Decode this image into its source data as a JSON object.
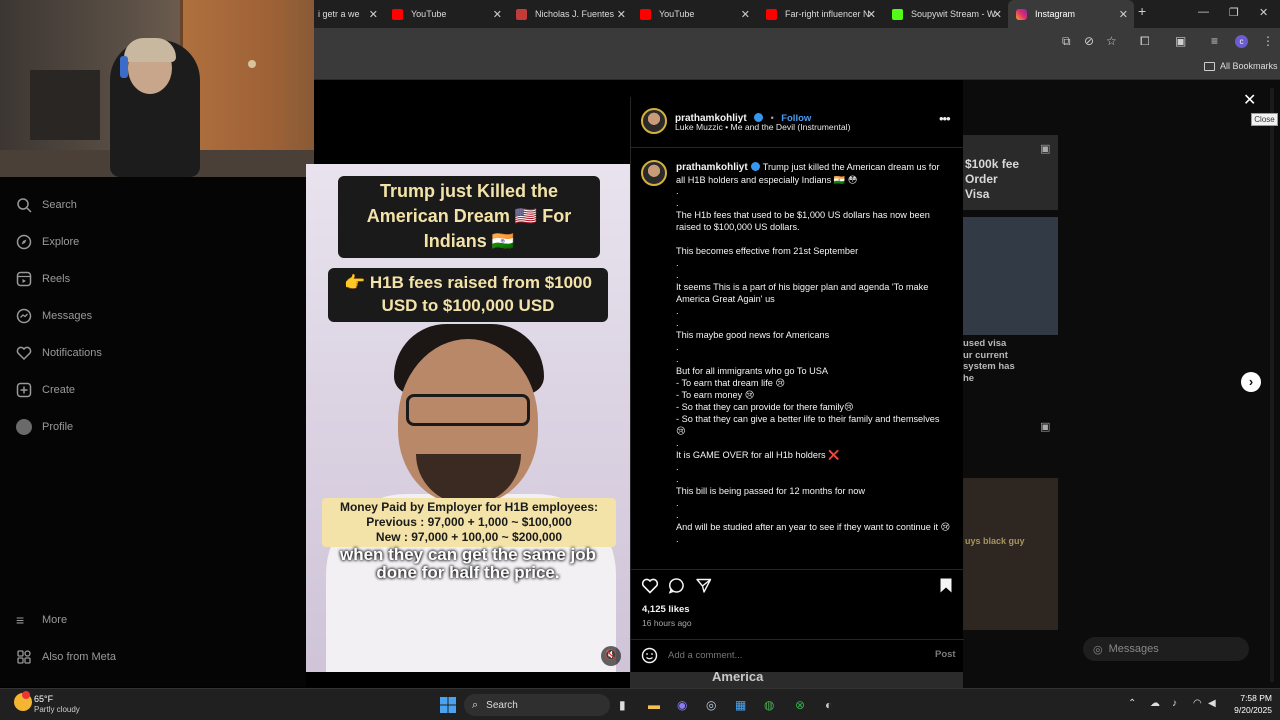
{
  "browser": {
    "tabs": [
      {
        "title": "i getr a we",
        "favicon_color": "#888888",
        "active": false
      },
      {
        "title": "YouTube",
        "favicon_color": "#ff0000",
        "active": false
      },
      {
        "title": "Nicholas J. Fuentes",
        "favicon_color": "#c23b3b",
        "active": false
      },
      {
        "title": "YouTube",
        "favicon_color": "#ff0000",
        "active": false
      },
      {
        "title": "Far-right influencer N",
        "favicon_color": "#ff0000",
        "active": false
      },
      {
        "title": "Soupywit Stream - W",
        "favicon_color": "#53fc18",
        "active": false
      },
      {
        "title": "Instagram",
        "favicon_color": "#e1306c",
        "active": true
      }
    ],
    "bookmarks_label": "All Bookmarks"
  },
  "sidebar": {
    "items": [
      {
        "label": "Search",
        "icon": "search-icon"
      },
      {
        "label": "Explore",
        "icon": "compass-icon"
      },
      {
        "label": "Reels",
        "icon": "reels-icon"
      },
      {
        "label": "Messages",
        "icon": "messenger-icon"
      },
      {
        "label": "Notifications",
        "icon": "heart-icon"
      },
      {
        "label": "Create",
        "icon": "plus-square-icon"
      },
      {
        "label": "Profile",
        "icon": "avatar-icon"
      }
    ],
    "more_label": "More",
    "meta_label": "Also from Meta"
  },
  "reel": {
    "headline": "Trump just Killed the American Dream 🇺🇸 For Indians 🇮🇳",
    "subheadline": "👉 H1B fees raised from $1000 USD to $100,000 USD",
    "overlay_lines": [
      "Money Paid by Employer for H1B employees:",
      "Previous : 97,000 + 1,000 ~ $100,000",
      "New : 97,000 + 100,00 ~ $200,000"
    ],
    "caption": "when they can get the same job done for half the price."
  },
  "post": {
    "username": "prathamkohliyt",
    "follow_label": "Follow",
    "audio": "Luke Muzzic • Me and the Devil (Instrumental)",
    "caption_lead": "Trump just killed the American dream us for all H1B holders and especially Indians 🇮🇳 😳",
    "caption_body": ".\n.\nThe H1b fees that used to be $1,000 US dollars has now been raised to $100,000 US dollars.\n\nThis becomes effective from 21st September\n.\n.\nIt seems This is a part of his bigger plan and agenda 'To make America Great Again' us\n.\n.\nThis maybe good news for Americans\n.\n.\nBut for all immigrants who go To USA\n- To earn that dream life 😢\n- To earn money 😢\n- So that they can provide for there family😢\n- So that they can give a better life to their family and themselves 😢\n.\nIt is GAME OVER for all H1b holders ❌\n.\n.\nThis bill is being passed for 12 months for now\n.\n.\nAnd will be studied after an year to see if they want to continue it 😢\n.",
    "likes": "4,125 likes",
    "time": "16 hours ago",
    "comment_placeholder": "Add a comment...",
    "post_label": "Post"
  },
  "overlay": {
    "close_tooltip": "Close"
  },
  "background": {
    "visible_texts": [
      "$100k fee",
      "Order",
      "Visa",
      "used visa",
      "ur current",
      "system has",
      "he",
      "uys black guy",
      "America"
    ],
    "messages_label": "Messages"
  },
  "taskbar": {
    "temperature": "65°F",
    "weather": "Partly cloudy",
    "search_label": "Search",
    "time": "7:58 PM",
    "date": "9/20/2025"
  }
}
